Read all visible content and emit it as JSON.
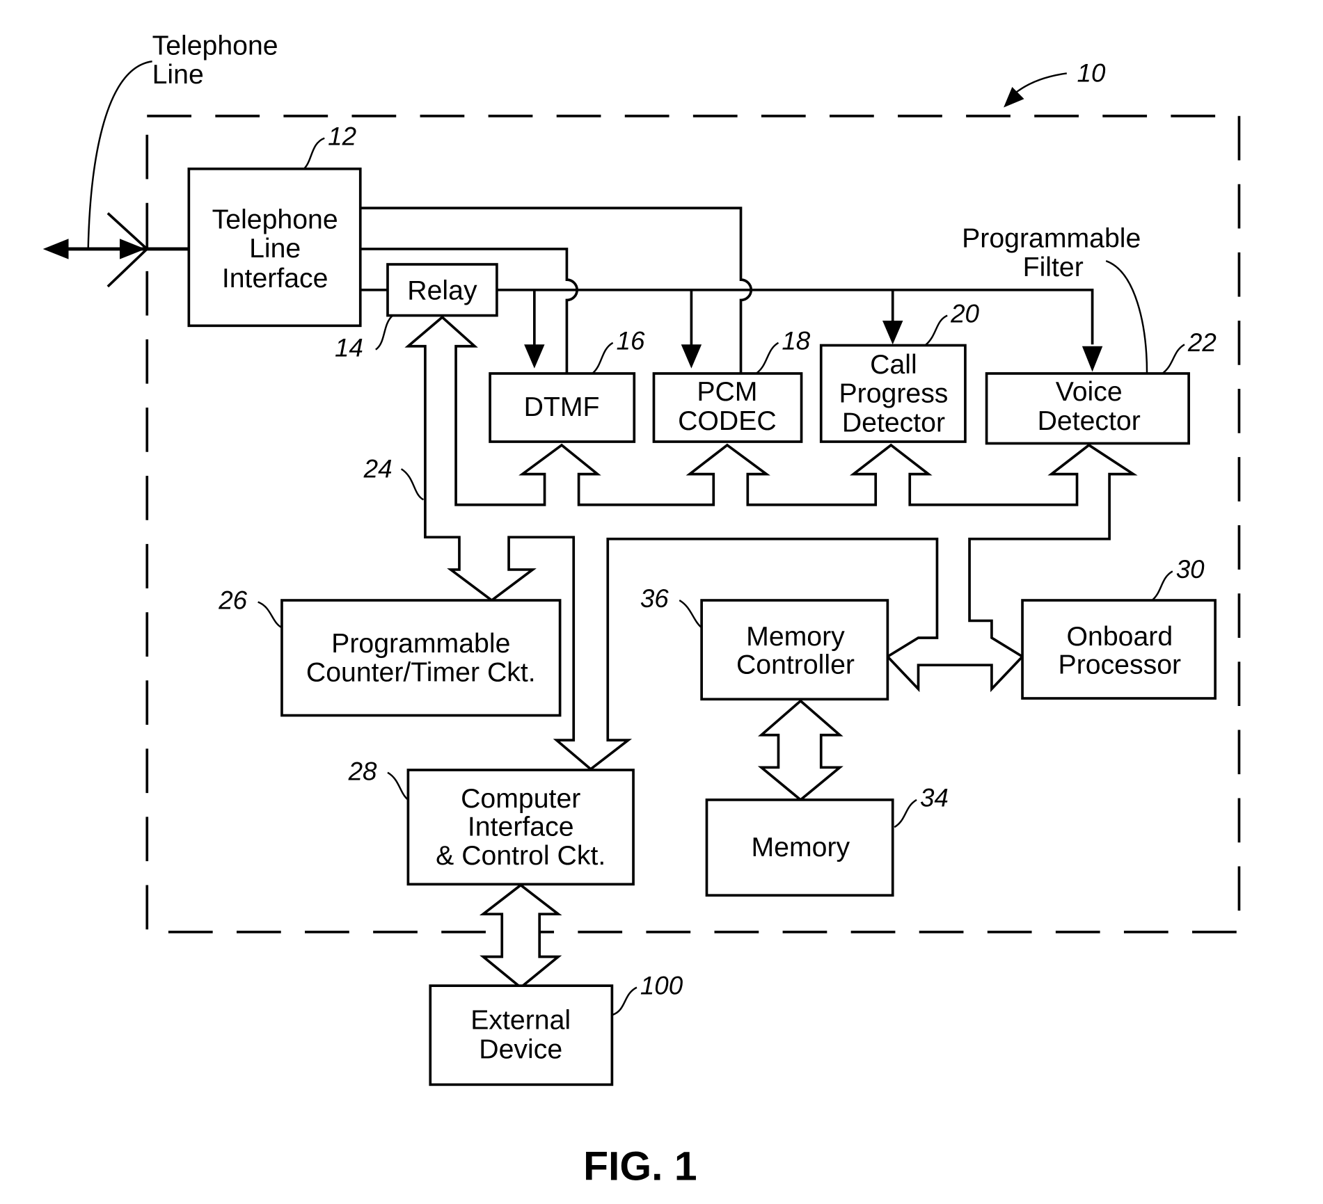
{
  "figure": {
    "caption": "FIG. 1",
    "system_ref": "10",
    "telephone_line_label": [
      "Telephone",
      "Line"
    ],
    "programmable_filter_label": [
      "Programmable",
      "Filter"
    ]
  },
  "blocks": {
    "tli": {
      "ref": "12",
      "lines": [
        "Telephone",
        "Line",
        "Interface"
      ]
    },
    "relay": {
      "ref": "14",
      "lines": [
        "Relay"
      ]
    },
    "dtmf": {
      "ref": "16",
      "lines": [
        "DTMF"
      ]
    },
    "pcm": {
      "ref": "18",
      "lines": [
        "PCM",
        "CODEC"
      ]
    },
    "cpd": {
      "ref": "20",
      "lines": [
        "Call",
        "Progress",
        "Detector"
      ]
    },
    "voice": {
      "ref": "22",
      "lines": [
        "Voice",
        "Detector"
      ]
    },
    "bus": {
      "ref": "24"
    },
    "counter": {
      "ref": "26",
      "lines": [
        "Programmable",
        "Counter/Timer Ckt."
      ]
    },
    "cic": {
      "ref": "28",
      "lines": [
        "Computer",
        "Interface",
        "& Control Ckt."
      ]
    },
    "proc": {
      "ref": "30",
      "lines": [
        "Onboard",
        "Processor"
      ]
    },
    "mem": {
      "ref": "34",
      "lines": [
        "Memory"
      ]
    },
    "memctl": {
      "ref": "36",
      "lines": [
        "Memory",
        "Controller"
      ]
    },
    "ext": {
      "ref": "100",
      "lines": [
        "External",
        "Device"
      ]
    }
  }
}
